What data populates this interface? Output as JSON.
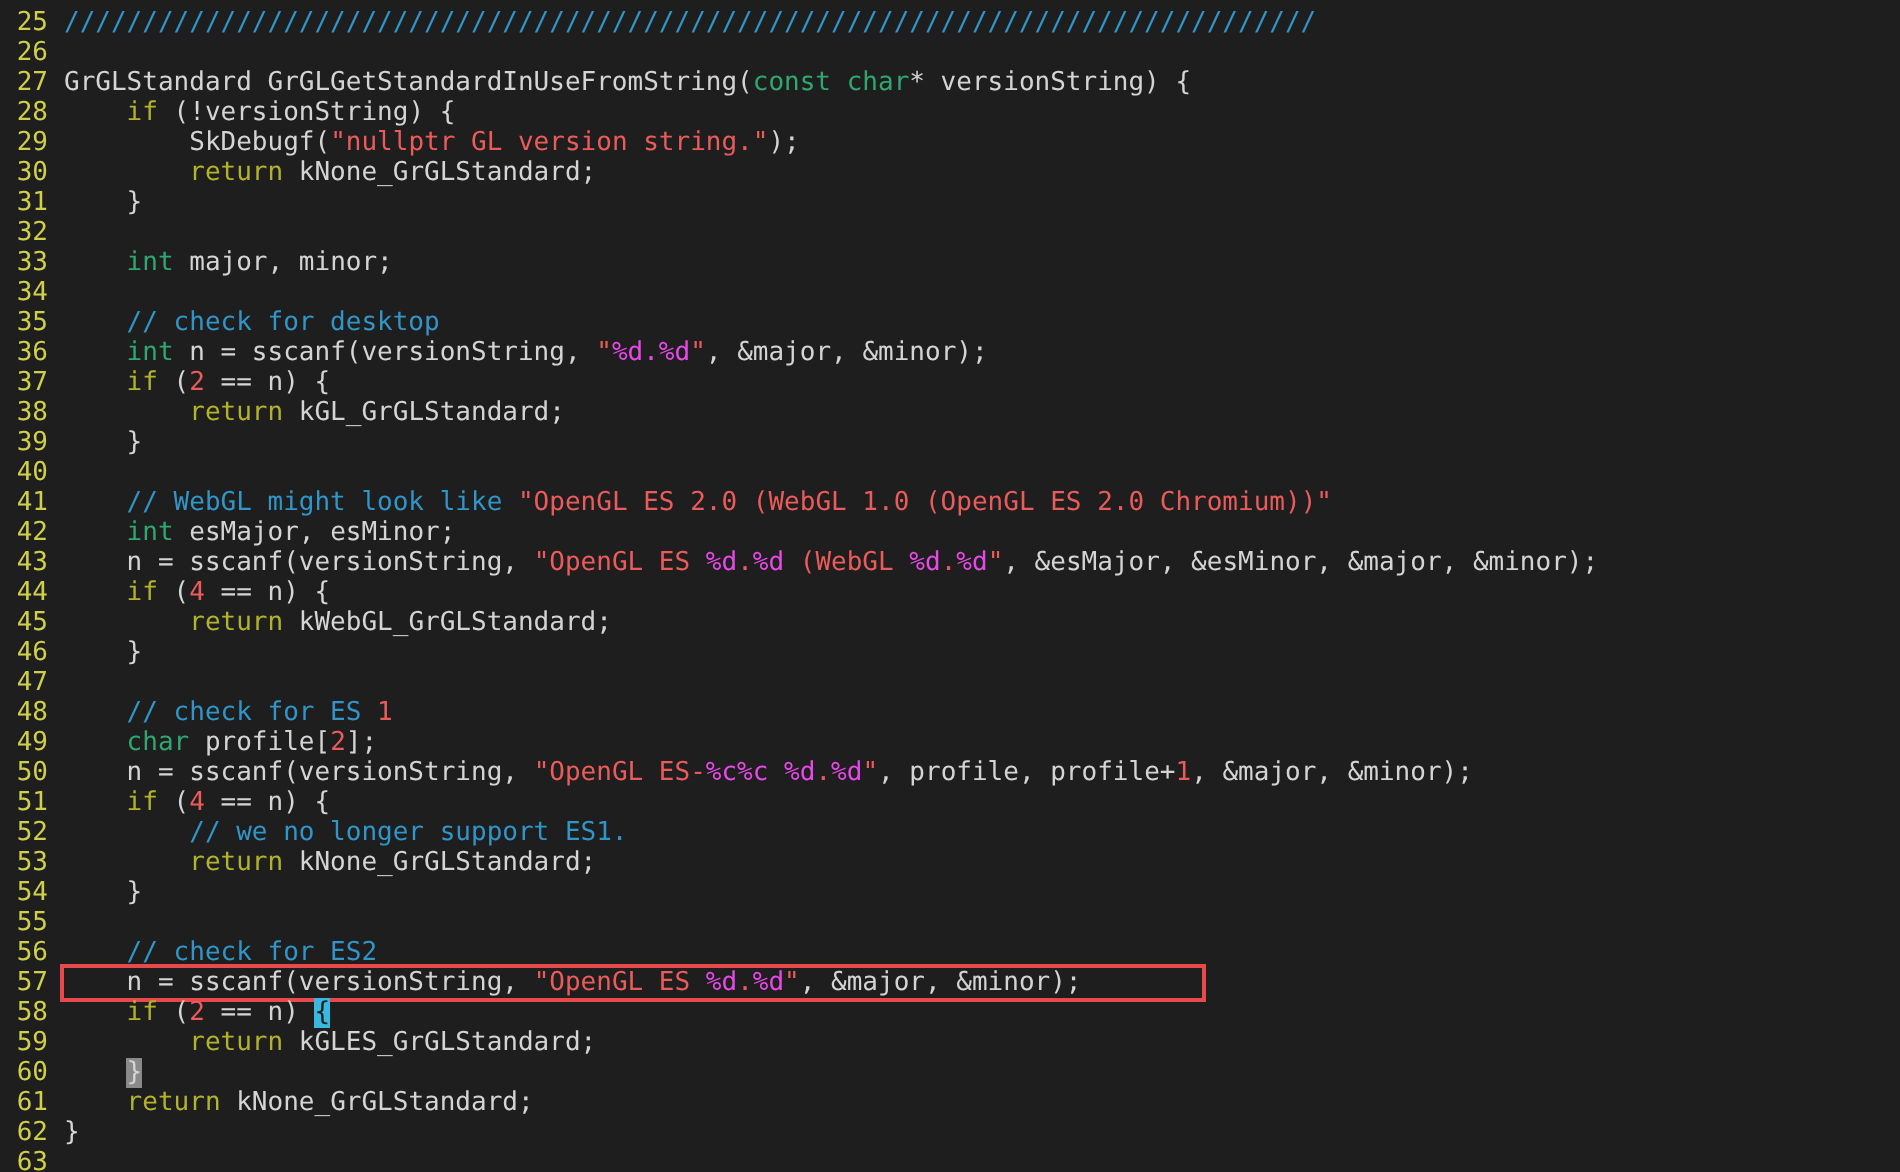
{
  "lines": [
    {
      "number": "25",
      "tokens": [
        {
          "kind": "comment",
          "text": "////////////////////////////////////////////////////////////////////////////////"
        }
      ]
    },
    {
      "number": "26"
    },
    {
      "number": "27",
      "tokens": [
        {
          "kind": "plain",
          "text": "GrGLStandard GrGLGetStandardInUseFromString("
        },
        {
          "kind": "type",
          "text": "const char"
        },
        {
          "kind": "plain",
          "text": "* versionString) {"
        }
      ]
    },
    {
      "number": "28",
      "tokens": [
        {
          "kind": "keyword",
          "text": "    if"
        },
        {
          "kind": "plain",
          "text": " (!versionString) {"
        }
      ]
    },
    {
      "number": "29",
      "tokens": [
        {
          "kind": "plain",
          "text": "        SkDebugf("
        },
        {
          "kind": "string",
          "text": "\"nullptr GL version string.\""
        },
        {
          "kind": "plain",
          "text": ");"
        }
      ]
    },
    {
      "number": "30",
      "tokens": [
        {
          "kind": "keyword",
          "text": "        return"
        },
        {
          "kind": "plain",
          "text": " kNone_GrGLStandard;"
        }
      ]
    },
    {
      "number": "31",
      "tokens": [
        {
          "kind": "plain",
          "text": "    }"
        }
      ]
    },
    {
      "number": "32"
    },
    {
      "number": "33",
      "tokens": [
        {
          "kind": "type",
          "text": "    int"
        },
        {
          "kind": "plain",
          "text": " major, minor;"
        }
      ]
    },
    {
      "number": "34"
    },
    {
      "number": "35",
      "tokens": [
        {
          "kind": "comment",
          "text": "    // check for desktop"
        }
      ]
    },
    {
      "number": "36",
      "tokens": [
        {
          "kind": "type",
          "text": "    int"
        },
        {
          "kind": "plain",
          "text": " n = sscanf(versionString, "
        },
        {
          "kind": "string",
          "text": "\""
        },
        {
          "kind": "format",
          "text": "%d.%d"
        },
        {
          "kind": "string",
          "text": "\""
        },
        {
          "kind": "plain",
          "text": ", &major, &minor);"
        }
      ]
    },
    {
      "number": "37",
      "tokens": [
        {
          "kind": "keyword",
          "text": "    if"
        },
        {
          "kind": "plain",
          "text": " ("
        },
        {
          "kind": "number",
          "text": "2"
        },
        {
          "kind": "plain",
          "text": " == n) {"
        }
      ]
    },
    {
      "number": "38",
      "tokens": [
        {
          "kind": "keyword",
          "text": "        return"
        },
        {
          "kind": "plain",
          "text": " kGL_GrGLStandard;"
        }
      ]
    },
    {
      "number": "39",
      "tokens": [
        {
          "kind": "plain",
          "text": "    }"
        }
      ]
    },
    {
      "number": "40"
    },
    {
      "number": "41",
      "tokens": [
        {
          "kind": "comment",
          "text": "    // WebGL might look like "
        },
        {
          "kind": "string",
          "text": "\"OpenGL ES 2.0 (WebGL 1.0 (OpenGL ES 2.0 Chromium))\""
        }
      ]
    },
    {
      "number": "42",
      "tokens": [
        {
          "kind": "type",
          "text": "    int"
        },
        {
          "kind": "plain",
          "text": " esMajor, esMinor;"
        }
      ]
    },
    {
      "number": "43",
      "tokens": [
        {
          "kind": "plain",
          "text": "    n = sscanf(versionString, "
        },
        {
          "kind": "string",
          "text": "\"OpenGL ES "
        },
        {
          "kind": "format",
          "text": "%d"
        },
        {
          "kind": "string",
          "text": "."
        },
        {
          "kind": "format",
          "text": "%d"
        },
        {
          "kind": "string",
          "text": " (WebGL "
        },
        {
          "kind": "format",
          "text": "%d"
        },
        {
          "kind": "string",
          "text": "."
        },
        {
          "kind": "format",
          "text": "%d"
        },
        {
          "kind": "string",
          "text": "\""
        },
        {
          "kind": "plain",
          "text": ", &esMajor, &esMinor, &major, &minor);"
        }
      ]
    },
    {
      "number": "44",
      "tokens": [
        {
          "kind": "keyword",
          "text": "    if"
        },
        {
          "kind": "plain",
          "text": " ("
        },
        {
          "kind": "number",
          "text": "4"
        },
        {
          "kind": "plain",
          "text": " == n) {"
        }
      ]
    },
    {
      "number": "45",
      "tokens": [
        {
          "kind": "keyword",
          "text": "        return"
        },
        {
          "kind": "plain",
          "text": " kWebGL_GrGLStandard;"
        }
      ]
    },
    {
      "number": "46",
      "tokens": [
        {
          "kind": "plain",
          "text": "    }"
        }
      ]
    },
    {
      "number": "47"
    },
    {
      "number": "48",
      "tokens": [
        {
          "kind": "comment",
          "text": "    // check for ES "
        },
        {
          "kind": "number",
          "text": "1"
        }
      ]
    },
    {
      "number": "49",
      "tokens": [
        {
          "kind": "type",
          "text": "    char"
        },
        {
          "kind": "plain",
          "text": " profile["
        },
        {
          "kind": "number",
          "text": "2"
        },
        {
          "kind": "plain",
          "text": "];"
        }
      ]
    },
    {
      "number": "50",
      "tokens": [
        {
          "kind": "plain",
          "text": "    n = sscanf(versionString, "
        },
        {
          "kind": "string",
          "text": "\"OpenGL ES-"
        },
        {
          "kind": "format",
          "text": "%c%c %d"
        },
        {
          "kind": "string",
          "text": "."
        },
        {
          "kind": "format",
          "text": "%d"
        },
        {
          "kind": "string",
          "text": "\""
        },
        {
          "kind": "plain",
          "text": ", profile, profile+"
        },
        {
          "kind": "number",
          "text": "1"
        },
        {
          "kind": "plain",
          "text": ", &major, &minor);"
        }
      ]
    },
    {
      "number": "51",
      "tokens": [
        {
          "kind": "keyword",
          "text": "    if"
        },
        {
          "kind": "plain",
          "text": " ("
        },
        {
          "kind": "number",
          "text": "4"
        },
        {
          "kind": "plain",
          "text": " == n) {"
        }
      ]
    },
    {
      "number": "52",
      "tokens": [
        {
          "kind": "comment",
          "text": "        // we no longer support ES1."
        }
      ]
    },
    {
      "number": "53",
      "tokens": [
        {
          "kind": "keyword",
          "text": "        return"
        },
        {
          "kind": "plain",
          "text": " kNone_GrGLStandard;"
        }
      ]
    },
    {
      "number": "54",
      "tokens": [
        {
          "kind": "plain",
          "text": "    }"
        }
      ]
    },
    {
      "number": "55"
    },
    {
      "number": "56",
      "tokens": [
        {
          "kind": "comment",
          "text": "    // check for ES2"
        }
      ]
    },
    {
      "number": "57",
      "highlighted": true,
      "tokens": [
        {
          "kind": "plain",
          "text": "    n = sscanf(versionString, "
        },
        {
          "kind": "string",
          "text": "\"OpenGL ES "
        },
        {
          "kind": "format",
          "text": "%d"
        },
        {
          "kind": "string",
          "text": "."
        },
        {
          "kind": "format",
          "text": "%d"
        },
        {
          "kind": "string",
          "text": "\""
        },
        {
          "kind": "plain",
          "text": ", &major, &minor);"
        }
      ]
    },
    {
      "number": "58",
      "tokens": [
        {
          "kind": "keyword",
          "text": "    if"
        },
        {
          "kind": "plain",
          "text": " ("
        },
        {
          "kind": "number",
          "text": "2"
        },
        {
          "kind": "plain",
          "text": " == n)"
        },
        {
          "kind": "cursor",
          "text": "{"
        }
      ]
    },
    {
      "number": "59",
      "tokens": [
        {
          "kind": "keyword",
          "text": "        return"
        },
        {
          "kind": "plain",
          "text": " kGLES_GrGLStandard;"
        }
      ]
    },
    {
      "number": "60",
      "tokens": [
        {
          "kind": "match",
          "text": "}"
        }
      ]
    },
    {
      "number": "61",
      "tokens": [
        {
          "kind": "keyword",
          "text": "    return"
        },
        {
          "kind": "plain",
          "text": " kNone_GrGLStandard;"
        }
      ]
    },
    {
      "number": "62",
      "tokens": [
        {
          "kind": "plain",
          "text": "}"
        }
      ]
    },
    {
      "number": "63"
    }
  ]
}
